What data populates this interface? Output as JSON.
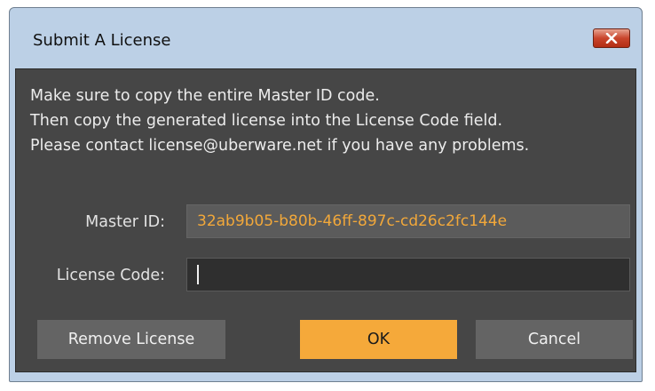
{
  "window": {
    "title": "Submit A License",
    "close_icon": "close-icon"
  },
  "info": {
    "line1": "Make sure to copy the entire Master ID code.",
    "line2": "Then copy the generated license into the License Code field.",
    "line3": "Please contact license@uberware.net if you have any problems."
  },
  "form": {
    "master_id_label": "Master ID:",
    "master_id_value": "32ab9b05-b80b-46ff-897c-cd26c2fc144e",
    "license_code_label": "License Code:",
    "license_code_value": ""
  },
  "buttons": {
    "remove_label": "Remove License",
    "ok_label": "OK",
    "cancel_label": "Cancel"
  },
  "colors": {
    "accent": "#f5a93a",
    "dialog_background": "#464646",
    "master_id_text": "#f2a83a"
  }
}
